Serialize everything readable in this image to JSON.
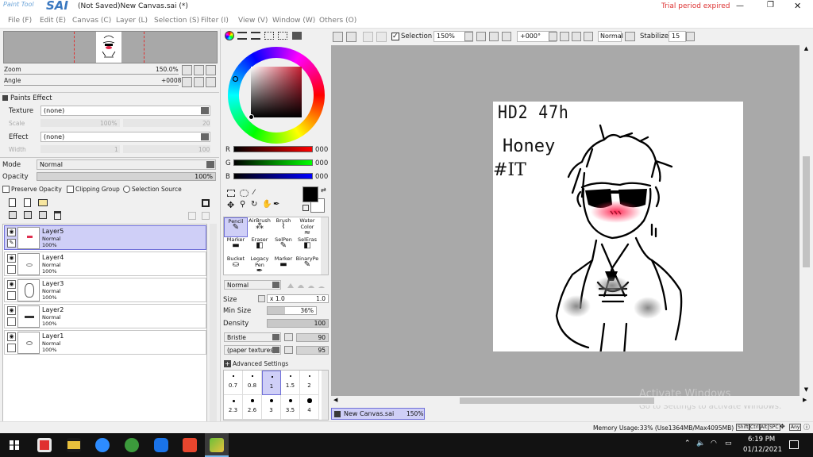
{
  "title": {
    "logo": "SAI",
    "logo_small": "Paint Tool",
    "document": "(Not Saved)New Canvas.sai (*)",
    "trial": "Trial period expired",
    "minimize": "—",
    "restore": "❐",
    "close": "✕"
  },
  "menu": [
    "File (F)",
    "Edit (E)",
    "Canvas (C)",
    "Layer (L)",
    "Selection (S)",
    "Filter (I)",
    "View (V)",
    "Window (W)",
    "Others (O)"
  ],
  "navigator": {
    "zoom_label": "Zoom",
    "zoom_value": "150.0%",
    "angle_label": "Angle",
    "angle_value": "+0008"
  },
  "paints_effect": {
    "header": "Paints Effect",
    "texture_label": "Texture",
    "texture_value": "(none)",
    "scale_label": "Scale",
    "scale_value": "100%",
    "scale_right": "20",
    "effect_label": "Effect",
    "effect_value": "(none)",
    "width_label": "Width",
    "width_value": "1",
    "width_right": "100"
  },
  "layer_props": {
    "mode_label": "Mode",
    "mode_value": "Normal",
    "opacity_label": "Opacity",
    "opacity_value": "100%",
    "preserve_opacity": "Preserve Opacity",
    "clipping_group": "Clipping Group",
    "selection_source": "Selection Source"
  },
  "layers": [
    {
      "name": "Layer5",
      "mode": "Normal",
      "opacity": "100%",
      "selected": true
    },
    {
      "name": "Layer4",
      "mode": "Normal",
      "opacity": "100%",
      "selected": false
    },
    {
      "name": "Layer3",
      "mode": "Normal",
      "opacity": "100%",
      "selected": false
    },
    {
      "name": "Layer2",
      "mode": "Normal",
      "opacity": "100%",
      "selected": false
    },
    {
      "name": "Layer1",
      "mode": "Normal",
      "opacity": "100%",
      "selected": false
    }
  ],
  "color": {
    "r_label": "R",
    "r_value": "000",
    "g_label": "G",
    "g_value": "000",
    "b_label": "B",
    "b_value": "000",
    "current": "#000000",
    "hue": "#c81e32"
  },
  "tools": [
    {
      "label": "Pencil",
      "selected": true
    },
    {
      "label": "AirBrush",
      "selected": false
    },
    {
      "label": "Brush",
      "selected": false
    },
    {
      "label": "Water Color",
      "selected": false
    },
    {
      "label": "Marker",
      "selected": false
    },
    {
      "label": "Eraser",
      "selected": false
    },
    {
      "label": "SelPen",
      "selected": false
    },
    {
      "label": "SelEras",
      "selected": false
    },
    {
      "label": "Bucket",
      "selected": false
    },
    {
      "label": "Legacy Pen",
      "selected": false
    },
    {
      "label": "Marker",
      "selected": false
    },
    {
      "label": "BinaryPe",
      "selected": false
    }
  ],
  "brush": {
    "mode": "Normal",
    "size_label": "Size",
    "size_mult": "x 1.0",
    "size_value": "1.0",
    "min_size_label": "Min Size",
    "min_size_value": "36%",
    "min_size_level": 0.36,
    "density_label": "Density",
    "density_value": "100",
    "density_level": 1.0,
    "shape": "Bristle",
    "shape_value": "90",
    "texture": "(paper textures)",
    "texture_value": "95",
    "advanced": "Advanced Settings"
  },
  "brush_sizes": [
    {
      "label": "0.7",
      "dot": 1,
      "selected": false
    },
    {
      "label": "0.8",
      "dot": 1,
      "selected": false
    },
    {
      "label": "1",
      "dot": 1,
      "selected": true
    },
    {
      "label": "1.5",
      "dot": 1.5,
      "selected": false
    },
    {
      "label": "2",
      "dot": 2,
      "selected": false
    },
    {
      "label": "2.3",
      "dot": 2.5,
      "selected": false
    },
    {
      "label": "2.6",
      "dot": 3,
      "selected": false
    },
    {
      "label": "3",
      "dot": 3.5,
      "selected": false
    },
    {
      "label": "3.5",
      "dot": 4,
      "selected": false
    },
    {
      "label": "4",
      "dot": 4.5,
      "selected": false
    }
  ],
  "toolbar": {
    "selection_label": "Selection",
    "zoom_value": "150%",
    "angle_value": "+000°",
    "blend_value": "Normal",
    "stabilizer_label": "Stabilizer",
    "stabilizer_value": "15"
  },
  "canvas": {
    "text_line1": "HD2 47h",
    "text_line2": "Honey",
    "text_line3": "#IT",
    "tab_name": "New Canvas.sai",
    "tab_zoom": "150%"
  },
  "watermark": {
    "line1": "Activate Windows",
    "line2": "Go to Settings to activate Windows."
  },
  "status": {
    "memory": "Memory Usage:33% (Use1364MB/Max4095MB)",
    "keys": [
      "Shift",
      "Ctrl",
      "Alt",
      "SPC",
      "Any"
    ]
  },
  "taskbar": {
    "time": "6:19 PM",
    "date": "01/12/2021"
  }
}
